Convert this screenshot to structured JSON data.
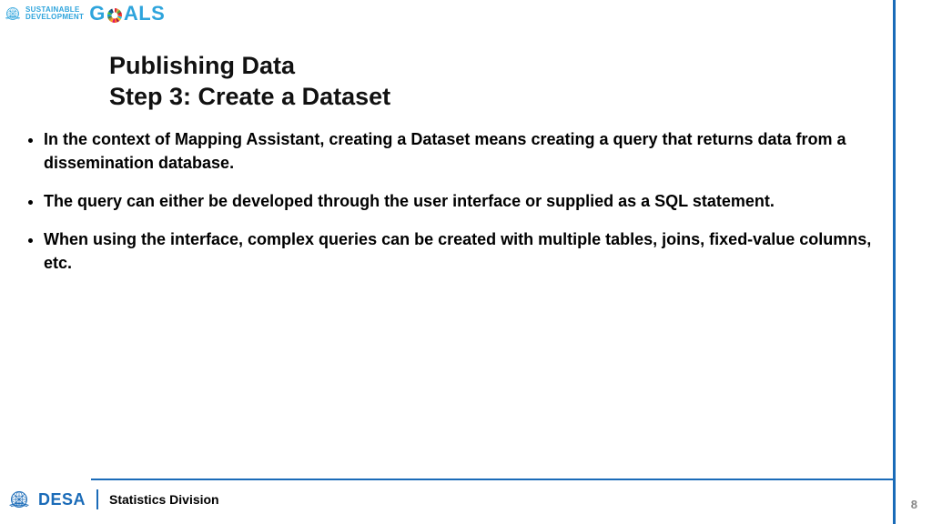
{
  "header": {
    "sdg_top": "SUSTAINABLE",
    "sdg_bot": "DEVELOPMENT",
    "goals_prefix": "G",
    "goals_suffix": "ALS"
  },
  "title": {
    "line1": "Publishing Data",
    "line2": "Step 3: Create a Dataset"
  },
  "bullets": [
    "In the context of Mapping Assistant, creating a Dataset means creating a query that returns data from a dissemination database.",
    "The query can either be developed through the user interface or supplied as a SQL statement.",
    "When using the interface, complex queries can be created with multiple tables, joins, fixed-value columns, etc."
  ],
  "footer": {
    "desa": "DESA",
    "division": "Statistics Division",
    "page": "8"
  }
}
